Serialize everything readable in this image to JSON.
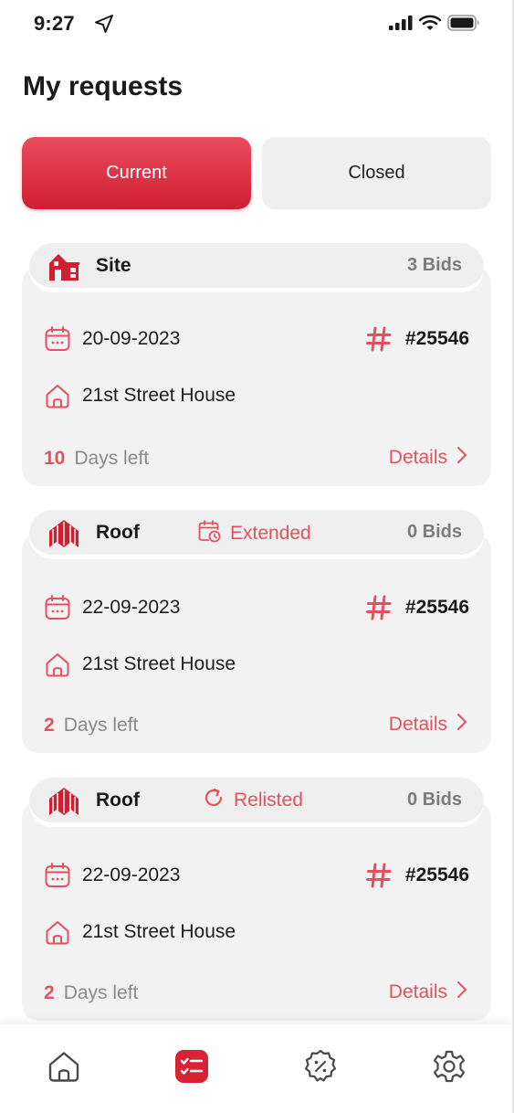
{
  "status_bar": {
    "time": "9:27"
  },
  "page": {
    "title": "My requests"
  },
  "tabs": [
    {
      "label": "Current",
      "active": true
    },
    {
      "label": "Closed",
      "active": false
    }
  ],
  "cards": [
    {
      "category": "Site",
      "category_icon": "site-building-icon",
      "status_tag": "",
      "bids": "3 Bids",
      "date": "20-09-2023",
      "reference": "#25546",
      "address": "21st Street House",
      "days_number": "10",
      "days_label": "Days left",
      "details_label": "Details"
    },
    {
      "category": "Roof",
      "category_icon": "roof-icon",
      "status_tag": "Extended",
      "status_tag_icon": "calendar-clock-icon",
      "bids": "0 Bids",
      "date": "22-09-2023",
      "reference": "#25546",
      "address": "21st Street House",
      "days_number": "2",
      "days_label": "Days left",
      "details_label": "Details"
    },
    {
      "category": "Roof",
      "category_icon": "roof-icon",
      "status_tag": "Relisted",
      "status_tag_icon": "refresh-icon",
      "bids": "0 Bids",
      "date": "22-09-2023",
      "reference": "#25546",
      "address": "21st Street House",
      "days_number": "2",
      "days_label": "Days left",
      "details_label": "Details"
    }
  ],
  "bottom_nav": [
    {
      "icon": "home-icon",
      "active": false
    },
    {
      "icon": "requests-list-icon",
      "active": true
    },
    {
      "icon": "discount-badge-icon",
      "active": false
    },
    {
      "icon": "settings-gear-icon",
      "active": false
    }
  ],
  "colors": {
    "accent": "#e3515f",
    "accent_gradient_top": "#e94c5e",
    "accent_gradient_bottom": "#cf1f31",
    "card_bg": "#f2f2f2",
    "muted_text": "#8a8a8a"
  }
}
